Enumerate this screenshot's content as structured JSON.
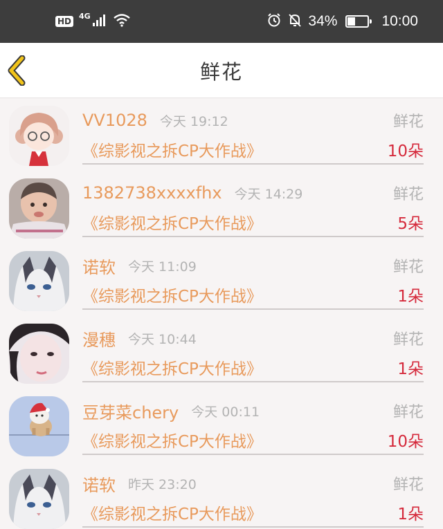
{
  "status_bar": {
    "hd": "HD",
    "network": "4G",
    "battery_percent": "34%",
    "battery_level": 0.34,
    "time": "10:00",
    "icons": [
      "signal-icon",
      "wifi-icon",
      "alarm-icon",
      "mute-bell-icon",
      "battery-icon"
    ]
  },
  "header": {
    "title": "鲜花",
    "back_icon": "chevron-left-icon",
    "accent_color": "#f2c41a"
  },
  "colors": {
    "name": "#e89a5c",
    "count": "#d5293b",
    "muted": "#b3b3b3"
  },
  "items": [
    {
      "user": "VV1028",
      "time": "今天 19:12",
      "gift": "鲜花",
      "show": "《综影视之拆CP大作战》",
      "count": "10朵"
    },
    {
      "user": "1382738xxxxfhx",
      "time": "今天 14:29",
      "gift": "鲜花",
      "show": "《综影视之拆CP大作战》",
      "count": "5朵"
    },
    {
      "user": "诺软",
      "time": "今天 11:09",
      "gift": "鲜花",
      "show": "《综影视之拆CP大作战》",
      "count": "1朵"
    },
    {
      "user": "漫穗",
      "time": "今天 10:44",
      "gift": "鲜花",
      "show": "《综影视之拆CP大作战》",
      "count": "1朵"
    },
    {
      "user": "豆芽菜chery",
      "time": "今天 00:11",
      "gift": "鲜花",
      "show": "《综影视之拆CP大作战》",
      "count": "10朵"
    },
    {
      "user": "诺软",
      "time": "昨天 23:20",
      "gift": "鲜花",
      "show": "《综影视之拆CP大作战》",
      "count": "1朵"
    }
  ]
}
